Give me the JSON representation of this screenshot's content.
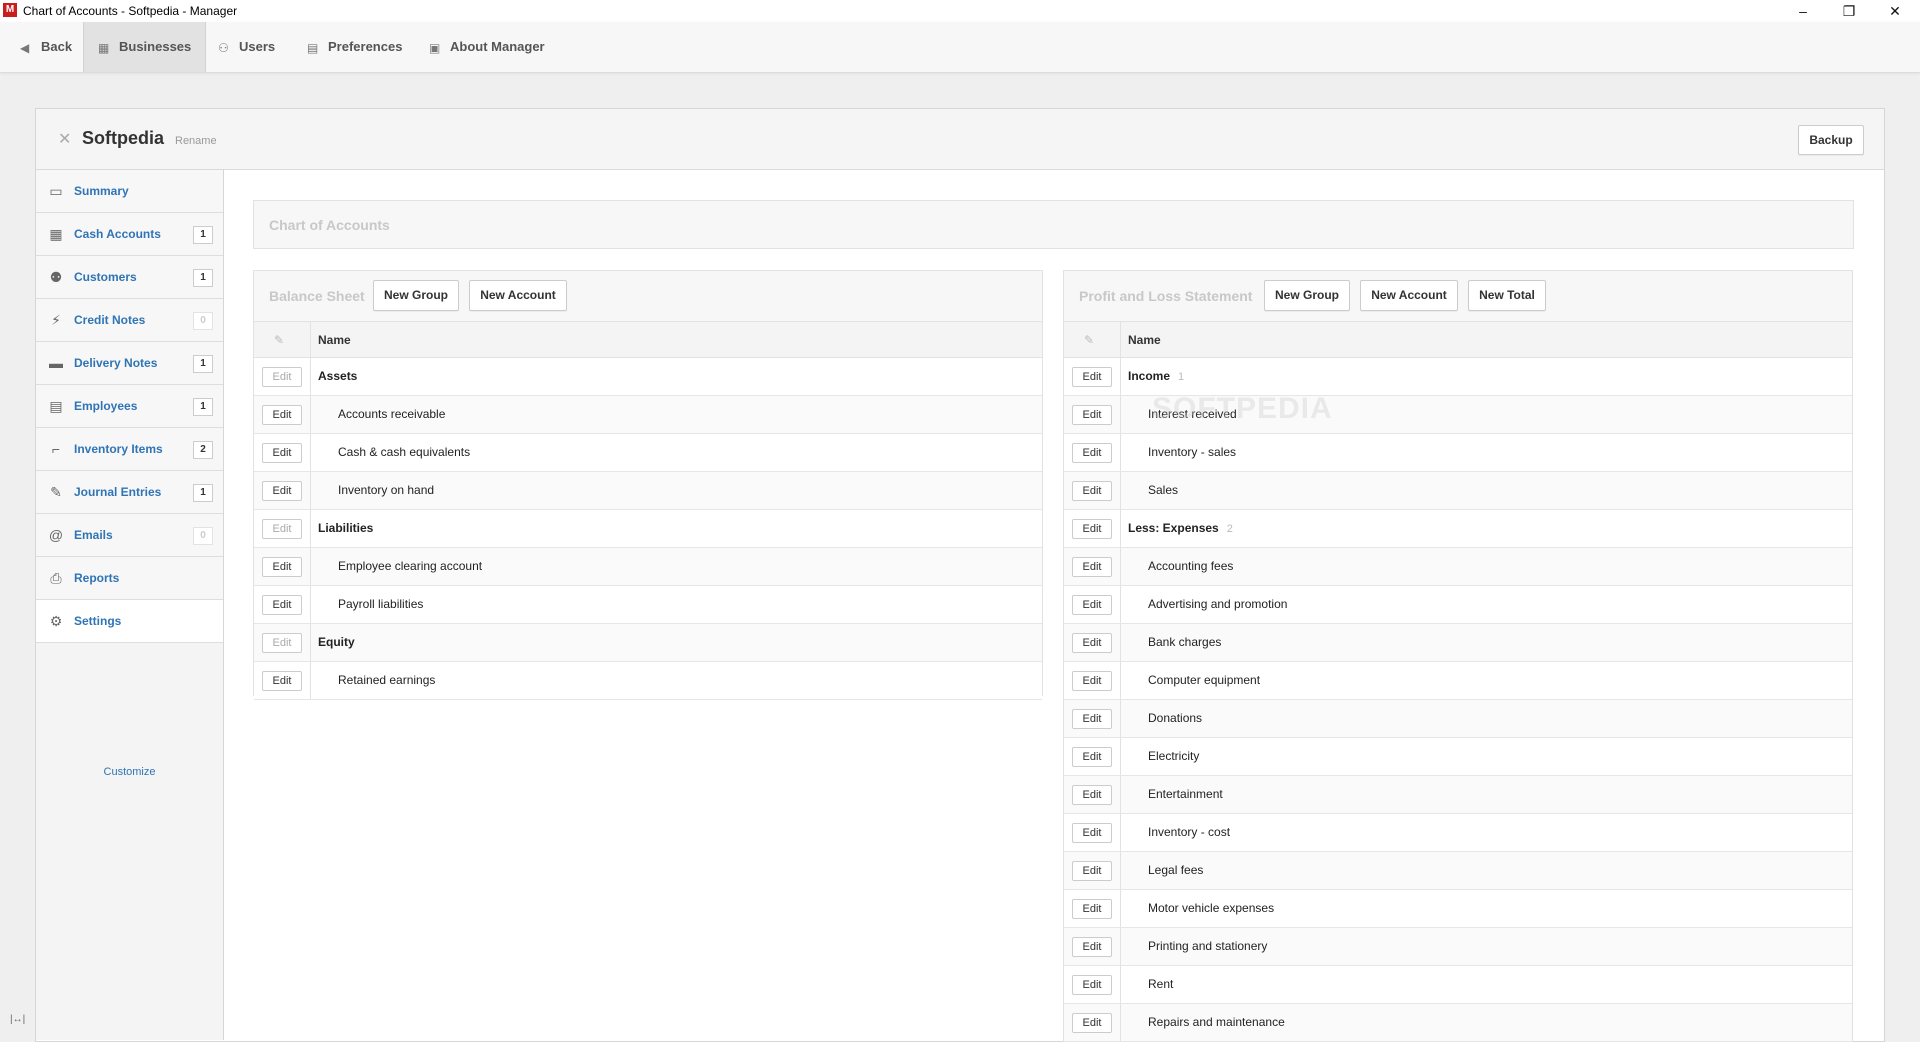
{
  "window": {
    "title": "Chart of Accounts - Softpedia - Manager",
    "app_icon": "M"
  },
  "toolbar": {
    "back": "Back",
    "businesses": "Businesses",
    "users": "Users",
    "preferences": "Preferences",
    "about": "About Manager"
  },
  "business": {
    "name": "Softpedia",
    "rename": "Rename",
    "backup": "Backup"
  },
  "sidebar": {
    "items": [
      {
        "label": "Summary",
        "count": "",
        "icon": "monitor-icon"
      },
      {
        "label": "Cash Accounts",
        "count": "1",
        "icon": "bank-icon"
      },
      {
        "label": "Customers",
        "count": "1",
        "icon": "people-icon"
      },
      {
        "label": "Credit Notes",
        "count": "0",
        "icon": "lightning-icon"
      },
      {
        "label": "Delivery Notes",
        "count": "1",
        "icon": "truck-icon"
      },
      {
        "label": "Employees",
        "count": "1",
        "icon": "id-card-icon"
      },
      {
        "label": "Inventory Items",
        "count": "2",
        "icon": "forklift-icon"
      },
      {
        "label": "Journal Entries",
        "count": "1",
        "icon": "pen-icon"
      },
      {
        "label": "Emails",
        "count": "0",
        "icon": "at-icon"
      },
      {
        "label": "Reports",
        "count": "",
        "icon": "printer-icon"
      },
      {
        "label": "Settings",
        "count": "",
        "icon": "gears-icon"
      }
    ],
    "customize": "Customize"
  },
  "main": {
    "title": "Chart of Accounts"
  },
  "balance_sheet": {
    "title": "Balance Sheet",
    "new_group": "New Group",
    "new_account": "New Account",
    "col_name": "Name",
    "edit_label": "Edit",
    "rows": [
      {
        "name": "Assets",
        "type": "group"
      },
      {
        "name": "Accounts receivable",
        "type": "account"
      },
      {
        "name": "Cash & cash equivalents",
        "type": "account"
      },
      {
        "name": "Inventory on hand",
        "type": "account"
      },
      {
        "name": "Liabilities",
        "type": "group"
      },
      {
        "name": "Employee clearing account",
        "type": "account"
      },
      {
        "name": "Payroll liabilities",
        "type": "account"
      },
      {
        "name": "Equity",
        "type": "group"
      },
      {
        "name": "Retained earnings",
        "type": "account"
      }
    ]
  },
  "profit_loss": {
    "title": "Profit and Loss Statement",
    "new_group": "New Group",
    "new_account": "New Account",
    "new_total": "New Total",
    "col_name": "Name",
    "edit_label": "Edit",
    "rows": [
      {
        "name": "Income",
        "type": "group",
        "count": "1"
      },
      {
        "name": "Interest received",
        "type": "account"
      },
      {
        "name": "Inventory - sales",
        "type": "account"
      },
      {
        "name": "Sales",
        "type": "account"
      },
      {
        "name": "Less: Expenses",
        "type": "group",
        "count": "2"
      },
      {
        "name": "Accounting fees",
        "type": "account"
      },
      {
        "name": "Advertising and promotion",
        "type": "account"
      },
      {
        "name": "Bank charges",
        "type": "account"
      },
      {
        "name": "Computer equipment",
        "type": "account"
      },
      {
        "name": "Donations",
        "type": "account"
      },
      {
        "name": "Electricity",
        "type": "account"
      },
      {
        "name": "Entertainment",
        "type": "account"
      },
      {
        "name": "Inventory - cost",
        "type": "account"
      },
      {
        "name": "Legal fees",
        "type": "account"
      },
      {
        "name": "Motor vehicle expenses",
        "type": "account"
      },
      {
        "name": "Printing and stationery",
        "type": "account"
      },
      {
        "name": "Rent",
        "type": "account"
      },
      {
        "name": "Repairs and maintenance",
        "type": "account"
      }
    ]
  },
  "watermark": "SOFTPEDIA",
  "colors": {
    "link": "#2f74b5",
    "brand": "#c81e1e"
  }
}
